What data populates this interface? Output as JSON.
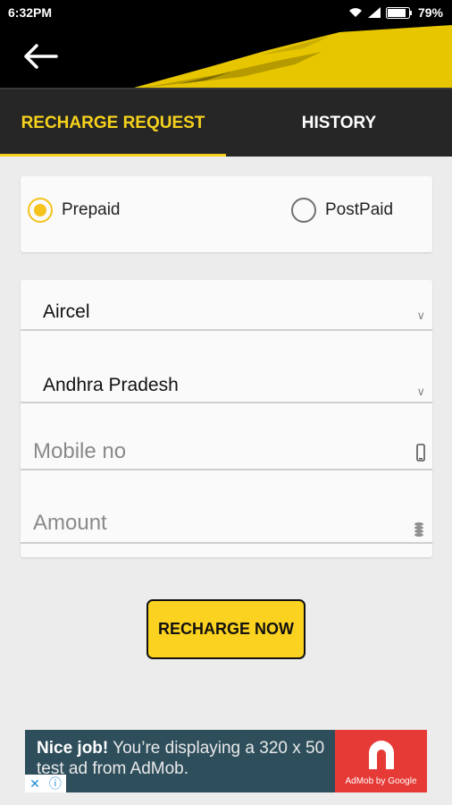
{
  "status_bar": {
    "time": "6:32PM",
    "battery": "79%"
  },
  "toolbar": {
    "back_icon": "arrow-left-icon"
  },
  "tabs": [
    {
      "label": "RECHARGE REQUEST",
      "active": true
    },
    {
      "label": "HISTORY",
      "active": false
    }
  ],
  "plan_type": {
    "options": [
      "Prepaid",
      "PostPaid"
    ],
    "selected": "Prepaid"
  },
  "form": {
    "operator": "Aircel",
    "circle": "Andhra Pradesh",
    "mobile_placeholder": "Mobile no",
    "amount_placeholder": "Amount"
  },
  "recharge_button": "RECHARGE NOW",
  "ad": {
    "headline": "Nice job!",
    "body": "You’re displaying a 320 x 50 test ad from AdMob.",
    "logo_text": "AdMob by Google"
  },
  "colors": {
    "accent": "#f6d21c",
    "tab_bar": "#262626",
    "ad_bg": "#2e4e5c",
    "ad_logo": "#e53a35"
  }
}
